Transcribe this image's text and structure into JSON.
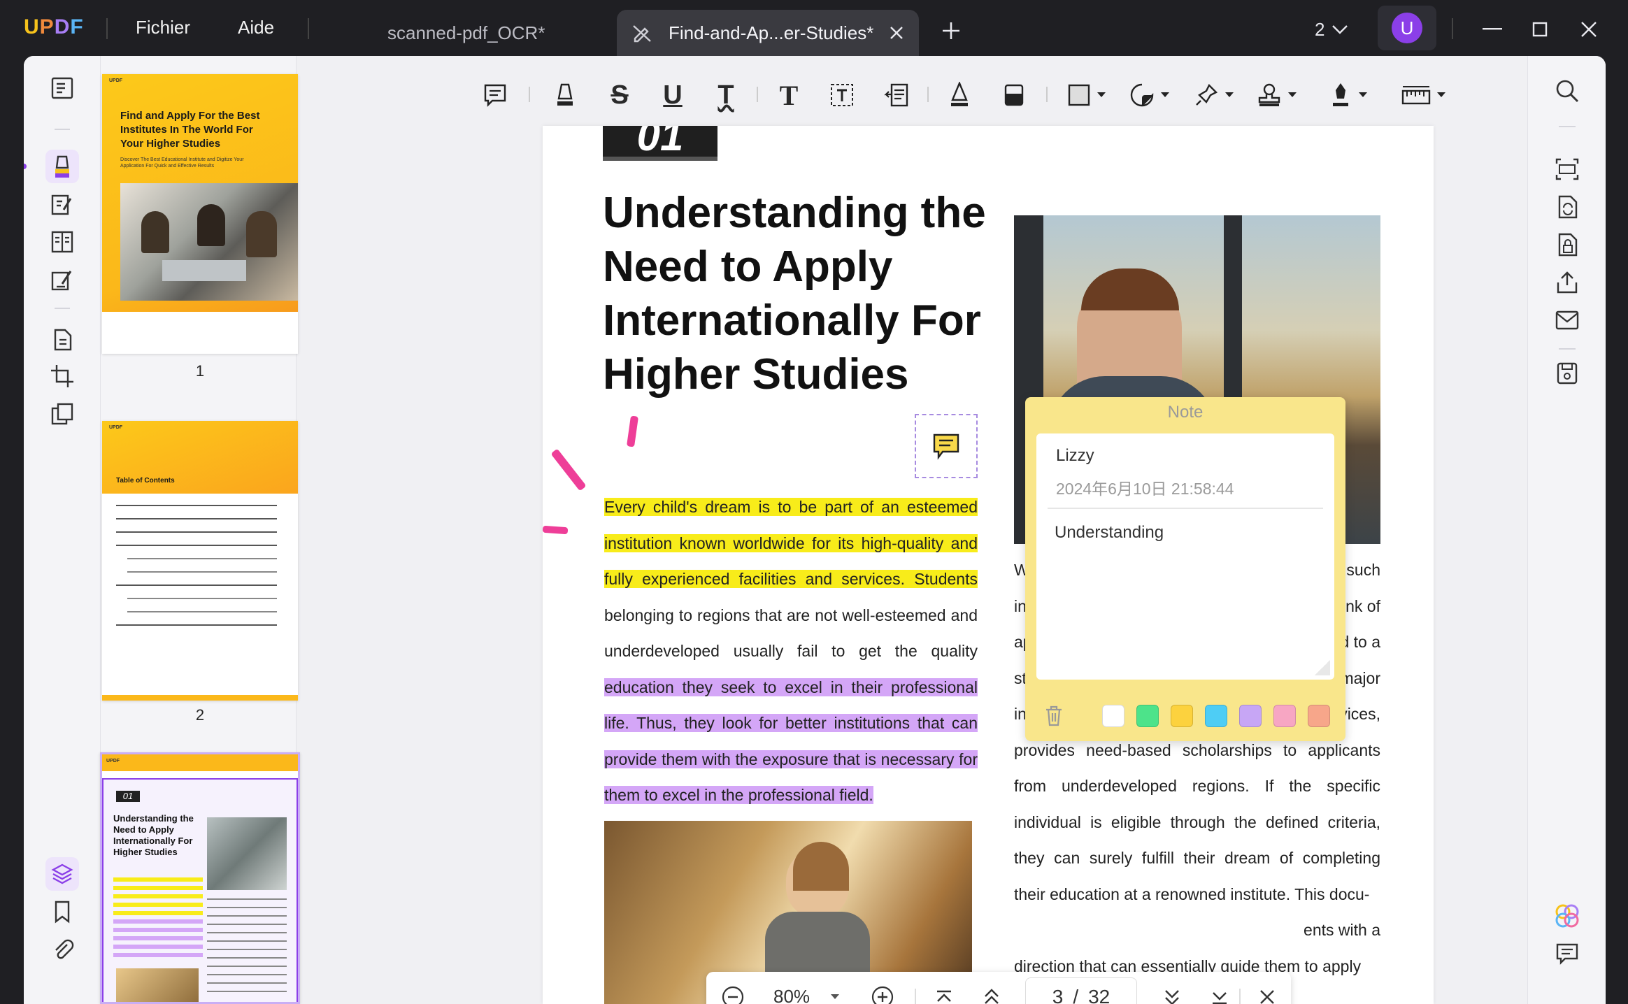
{
  "app": {
    "logo": "UPDF",
    "menu": [
      "Fichier",
      "Aide"
    ],
    "tabs": [
      {
        "label": "scanned-pdf_OCR*",
        "active": false
      },
      {
        "label": "Find-and-Ap...er-Studies*",
        "active": true
      }
    ],
    "window_count": "2",
    "user_initial": "U",
    "accent_color": "#8b3fe8"
  },
  "thumbnails": [
    {
      "page": "1",
      "title": "Find and Apply For the Best Institutes In The World For Your Higher Studies",
      "subtitle": "Discover The Best Educational Institute and Digitize Your Application For Quick and Effective Results"
    },
    {
      "page": "2",
      "title": "Table of Contents"
    },
    {
      "page": "3",
      "title": "Understanding the Need to Apply Internationally For Higher Studies",
      "chapter": "01"
    }
  ],
  "document": {
    "chapter": "01",
    "heading": "Understanding the Need to Apply Internationally For Higher Studies",
    "para_yellow": "Every child's dream is to be part of an esteemed institution known worldwide for its high-quality and fully experienced facilities and services. Students",
    "para_plain": " belonging to regions that are not well-esteemed and underdeveloped usually fail to get the quality ",
    "para_purple": "education they seek to excel in their professional life. Thus, they look for better institutions that can provide them with the exposure that is necessary for them to excel in the professional field.",
    "right_line_1": "W",
    "right_line_1_end": "such",
    "right_line_2": "in",
    "right_line_2_end": "nk of",
    "right_line_3": "ap",
    "right_line_3_end": "d to a",
    "right_text": "student's journey to excellence. Every major institution across the world, known for its services, provides need-based scholarships to applicants from underdeveloped regions. If the specific individual is eligible through the defined criteria, they can surely fulfill their dream of completing their education at a renowned institute. This docu-",
    "right_line_last_end": "ents with a",
    "right_final": "direction that can essentially guide them to apply"
  },
  "note": {
    "title": "Note",
    "author": "Lizzy",
    "date": "2024年6月10日 21:58:44",
    "body": "Understanding",
    "colors": [
      "#ffffff",
      "#4de38a",
      "#fcd23e",
      "#4ecdf5",
      "#c7a6f5",
      "#f7a6c3",
      "#f7a68a"
    ]
  },
  "zoombar": {
    "zoom": "80%",
    "current_page": "3",
    "separator": "/",
    "total_pages": "32"
  }
}
